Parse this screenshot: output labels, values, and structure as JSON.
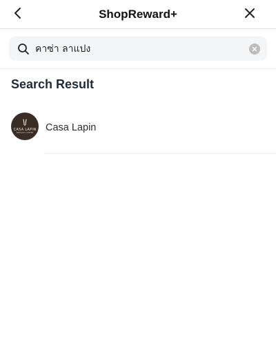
{
  "header": {
    "title": "ShopReward+",
    "back_icon": "chevron-left-icon",
    "close_icon": "close-icon"
  },
  "search": {
    "value": "คาซ่า ลาแปง",
    "placeholder": "",
    "search_icon": "search-icon",
    "clear_icon": "clear-circle-icon"
  },
  "results": {
    "section_title": "Search Result",
    "items": [
      {
        "name": "Casa Lapin",
        "logo_text": "CASA LAPIN",
        "logo_subtext": "SPECIALTY COFFEE"
      }
    ]
  },
  "colors": {
    "avatar_bg": "#3a2d25",
    "search_bg": "#f4f5f7",
    "section_title": "#1f2a37"
  }
}
